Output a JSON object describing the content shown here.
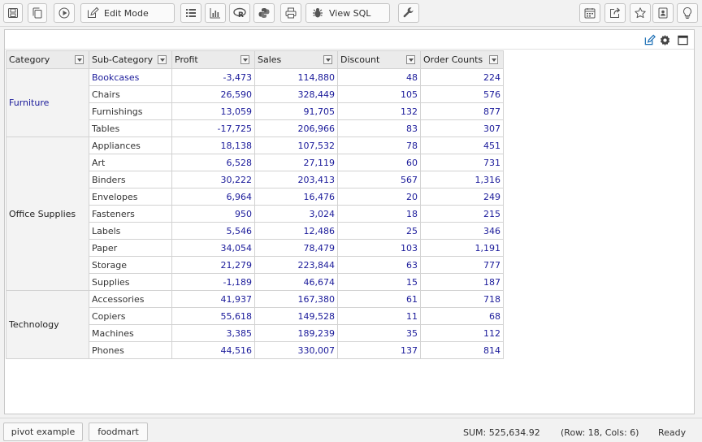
{
  "toolbar": {
    "icons": [
      "save-icon",
      "copy-icon",
      "run-icon",
      "edit-icon",
      "list-icon",
      "bar-chart-icon",
      "r-icon",
      "python-icon",
      "print-icon",
      "bug-icon",
      "wrench-icon",
      "calendar-icon",
      "share-icon",
      "star-icon",
      "contact-icon",
      "lightbulb-icon"
    ],
    "edit_mode_label": "Edit Mode",
    "view_sql_label": "View SQL"
  },
  "panel_tools": [
    "edit-icon",
    "gear-icon",
    "maximize-icon"
  ],
  "table": {
    "headers": [
      "Category",
      "Sub-Category",
      "Profit",
      "Sales",
      "Discount",
      "Order Counts"
    ],
    "groups": [
      {
        "category": "Furniture",
        "rows": [
          {
            "sub": "Bookcases",
            "profit": "-3,473",
            "sales": "114,880",
            "discount": "48",
            "orders": "224"
          },
          {
            "sub": "Chairs",
            "profit": "26,590",
            "sales": "328,449",
            "discount": "105",
            "orders": "576"
          },
          {
            "sub": "Furnishings",
            "profit": "13,059",
            "sales": "91,705",
            "discount": "132",
            "orders": "877"
          },
          {
            "sub": "Tables",
            "profit": "-17,725",
            "sales": "206,966",
            "discount": "83",
            "orders": "307"
          }
        ]
      },
      {
        "category": "Office Supplies",
        "rows": [
          {
            "sub": "Appliances",
            "profit": "18,138",
            "sales": "107,532",
            "discount": "78",
            "orders": "451"
          },
          {
            "sub": "Art",
            "profit": "6,528",
            "sales": "27,119",
            "discount": "60",
            "orders": "731"
          },
          {
            "sub": "Binders",
            "profit": "30,222",
            "sales": "203,413",
            "discount": "567",
            "orders": "1,316"
          },
          {
            "sub": "Envelopes",
            "profit": "6,964",
            "sales": "16,476",
            "discount": "20",
            "orders": "249"
          },
          {
            "sub": "Fasteners",
            "profit": "950",
            "sales": "3,024",
            "discount": "18",
            "orders": "215"
          },
          {
            "sub": "Labels",
            "profit": "5,546",
            "sales": "12,486",
            "discount": "25",
            "orders": "346"
          },
          {
            "sub": "Paper",
            "profit": "34,054",
            "sales": "78,479",
            "discount": "103",
            "orders": "1,191"
          },
          {
            "sub": "Storage",
            "profit": "21,279",
            "sales": "223,844",
            "discount": "63",
            "orders": "777"
          },
          {
            "sub": "Supplies",
            "profit": "-1,189",
            "sales": "46,674",
            "discount": "15",
            "orders": "187"
          }
        ]
      },
      {
        "category": "Technology",
        "rows": [
          {
            "sub": "Accessories",
            "profit": "41,937",
            "sales": "167,380",
            "discount": "61",
            "orders": "718"
          },
          {
            "sub": "Copiers",
            "profit": "55,618",
            "sales": "149,528",
            "discount": "11",
            "orders": "68"
          },
          {
            "sub": "Machines",
            "profit": "3,385",
            "sales": "189,239",
            "discount": "35",
            "orders": "112"
          },
          {
            "sub": "Phones",
            "profit": "44,516",
            "sales": "330,007",
            "discount": "137",
            "orders": "814"
          }
        ]
      }
    ]
  },
  "status": {
    "tabs": [
      "pivot example",
      "foodmart"
    ],
    "sum": "SUM: 525,634.92",
    "rowcol": "(Row: 18, Cols: 6)",
    "state": "Ready"
  },
  "colors": {
    "link": "#1a1a9a",
    "header_bg": "#ebebeb",
    "accent_icon": "#1c6fb5"
  }
}
